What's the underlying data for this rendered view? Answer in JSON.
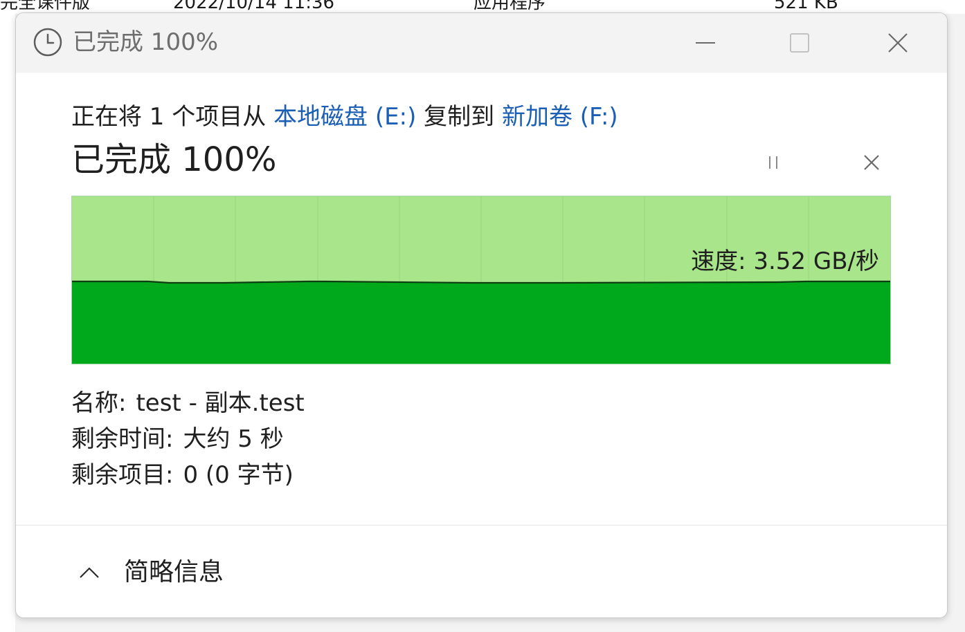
{
  "background": {
    "row_text": [
      "完全课件版",
      "2022/10/14 11:36",
      "应用程序",
      "521 KB"
    ]
  },
  "window": {
    "title": "已完成 100%",
    "controls": {
      "minimize_icon": "minimize-icon",
      "maximize_icon": "maximize-icon",
      "close_icon": "close-icon"
    }
  },
  "operation": {
    "prefix": "正在将 1 个项目从",
    "source": "本地磁盘 (E:)",
    "middle": "复制到",
    "destination": "新加卷 (F:)"
  },
  "status": {
    "title": "已完成 100%",
    "progress_fraction": 1.0
  },
  "graph": {
    "speed_label": "速度: 3.52 GB/秒",
    "colors": {
      "progress_fill": "#a8e58b",
      "throughput_fill": "#00a81c",
      "grid_line": "#98d87c"
    }
  },
  "details": {
    "name_label": "名称:",
    "name_value": "test - 副本.test",
    "time_label": "剩余时间:",
    "time_value": "大约 5 秒",
    "items_label": "剩余项目:",
    "items_value": "0 (0 字节)"
  },
  "footer": {
    "toggle_label": "简略信息"
  },
  "colors": {
    "link": "#1a5fb4",
    "title_text": "#6e6e6e"
  }
}
